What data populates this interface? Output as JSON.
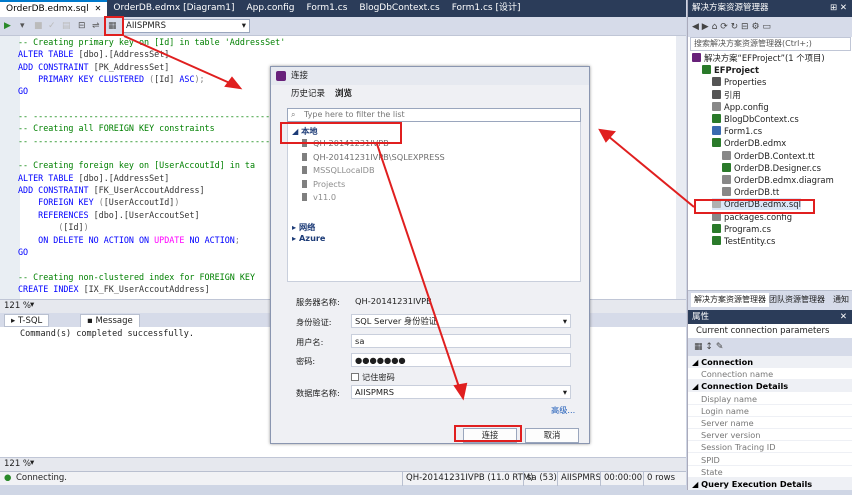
{
  "tabs": [
    {
      "label": "OrderDB.edmx.sql",
      "active": true
    },
    {
      "label": "OrderDB.edmx [Diagram1]"
    },
    {
      "label": "App.config"
    },
    {
      "label": "Form1.cs"
    },
    {
      "label": "BlogDbContext.cs"
    },
    {
      "label": "Form1.cs [设计]"
    }
  ],
  "toolbar": {
    "database_selected": "AIISPMRS"
  },
  "code_lines": [
    [
      {
        "t": "-- Creating primary key on [Id] in table 'AddressSet'",
        "c": "cm"
      }
    ],
    [
      {
        "t": "ALTER TABLE ",
        "c": "kw"
      },
      {
        "t": "[dbo].[AddressSet]",
        "c": "tx"
      }
    ],
    [
      {
        "t": "ADD CONSTRAINT ",
        "c": "kw"
      },
      {
        "t": "[PK_AddressSet]",
        "c": "tx"
      }
    ],
    [
      {
        "t": "    PRIMARY KEY CLUSTERED ",
        "c": "kw"
      },
      {
        "t": "(",
        "c": "gy"
      },
      {
        "t": "[Id] ",
        "c": "tx"
      },
      {
        "t": "ASC",
        "c": "kw"
      },
      {
        "t": ");",
        "c": "gy"
      }
    ],
    [
      {
        "t": "GO",
        "c": "kw"
      }
    ],
    [
      {
        "t": "",
        "c": "tx"
      }
    ],
    [
      {
        "t": "-- ----------------------------------------------------------",
        "c": "cm"
      }
    ],
    [
      {
        "t": "-- Creating all FOREIGN KEY constraints",
        "c": "cm"
      }
    ],
    [
      {
        "t": "-- ----------------------------------------------------------",
        "c": "cm"
      }
    ],
    [
      {
        "t": "",
        "c": "tx"
      }
    ],
    [
      {
        "t": "-- Creating foreign key on [UserAccoutId] in ta",
        "c": "cm"
      }
    ],
    [
      {
        "t": "ALTER TABLE ",
        "c": "kw"
      },
      {
        "t": "[dbo].[AddressSet]",
        "c": "tx"
      }
    ],
    [
      {
        "t": "ADD CONSTRAINT ",
        "c": "kw"
      },
      {
        "t": "[FK_UserAccoutAddress]",
        "c": "tx"
      }
    ],
    [
      {
        "t": "    FOREIGN KEY ",
        "c": "kw"
      },
      {
        "t": "(",
        "c": "gy"
      },
      {
        "t": "[UserAccoutId]",
        "c": "tx"
      },
      {
        "t": ")",
        "c": "gy"
      }
    ],
    [
      {
        "t": "    REFERENCES ",
        "c": "kw"
      },
      {
        "t": "[dbo].[UserAccoutSet]",
        "c": "tx"
      }
    ],
    [
      {
        "t": "        (",
        "c": "gy"
      },
      {
        "t": "[Id]",
        "c": "tx"
      },
      {
        "t": ")",
        "c": "gy"
      }
    ],
    [
      {
        "t": "    ON DELETE NO ACTION ON ",
        "c": "kw"
      },
      {
        "t": "UPDATE",
        "c": "mg"
      },
      {
        "t": " NO ACTION",
        "c": "kw"
      },
      {
        "t": ";",
        "c": "gy"
      }
    ],
    [
      {
        "t": "GO",
        "c": "kw"
      }
    ],
    [
      {
        "t": "",
        "c": "tx"
      }
    ],
    [
      {
        "t": "-- Creating non-clustered index for FOREIGN KEY",
        "c": "cm"
      }
    ],
    [
      {
        "t": "CREATE INDEX ",
        "c": "kw"
      },
      {
        "t": "[IX_FK_UserAccoutAddress]",
        "c": "tx"
      }
    ]
  ],
  "editor_zoom": "121 %",
  "results": {
    "tab1": "T-SQL",
    "tab2": "Message",
    "message": "Command(s) completed successfully."
  },
  "results_zoom": "121 %",
  "status": {
    "left": "Connecting.",
    "server": "QH-20141231IVPB (11.0 RTM)",
    "user": "sa (53)",
    "db": "AIISPMRS",
    "time": "00:00:00",
    "rows": "0 rows"
  },
  "solution_explorer": {
    "title": "解决方案资源管理器",
    "search_placeholder": "搜索解决方案资源管理器(Ctrl+;)",
    "items": [
      {
        "label": "解决方案“EFProject”(1 个项目)",
        "level": 0,
        "color": "#68217a"
      },
      {
        "label": "EFProject",
        "level": 1,
        "bold": true,
        "color": "#2a7a2a"
      },
      {
        "label": "Properties",
        "level": 2,
        "color": "#555"
      },
      {
        "label": "引用",
        "level": 2,
        "color": "#555"
      },
      {
        "label": "App.config",
        "level": 2,
        "color": "#888"
      },
      {
        "label": "BlogDbContext.cs",
        "level": 2,
        "color": "#2a7a2a"
      },
      {
        "label": "Form1.cs",
        "level": 2,
        "color": "#3a6ab0"
      },
      {
        "label": "OrderDB.edmx",
        "level": 2,
        "color": "#2a7a2a"
      },
      {
        "label": "OrderDB.Context.tt",
        "level": 3,
        "color": "#888"
      },
      {
        "label": "OrderDB.Designer.cs",
        "level": 3,
        "color": "#2a7a2a"
      },
      {
        "label": "OrderDB.edmx.diagram",
        "level": 3,
        "color": "#888"
      },
      {
        "label": "OrderDB.tt",
        "level": 3,
        "color": "#888"
      },
      {
        "label": "OrderDB.edmx.sql",
        "level": 2,
        "color": "#b0b0b0",
        "selected": true
      },
      {
        "label": "packages.config",
        "level": 2,
        "color": "#888"
      },
      {
        "label": "Program.cs",
        "level": 2,
        "color": "#2a7a2a"
      },
      {
        "label": "TestEntity.cs",
        "level": 2,
        "color": "#2a7a2a"
      }
    ],
    "bottom_tabs": [
      "解决方案资源管理器",
      "团队资源管理器",
      "通知"
    ]
  },
  "properties": {
    "title": "属性",
    "subtitle": "Current connection parameters",
    "rows": [
      {
        "label": "Connection",
        "cat": true
      },
      {
        "label": "Connection name"
      },
      {
        "label": "Connection Details",
        "cat": true
      },
      {
        "label": "Display name"
      },
      {
        "label": "Login name"
      },
      {
        "label": "Server name"
      },
      {
        "label": "Server version"
      },
      {
        "label": "Session Tracing ID"
      },
      {
        "label": "SPID"
      },
      {
        "label": "State"
      },
      {
        "label": "Query Execution Details",
        "cat": true
      }
    ]
  },
  "dialog": {
    "title": "连接",
    "tab_history": "历史记录",
    "tab_browse": "浏览",
    "filter_placeholder": "Type here to filter the list",
    "local": "本地",
    "servers": [
      "QH-20141231IVPB",
      "QH-20141231IVPB\\SQLEXPRESS",
      "MSSQLLocalDB",
      "Projects",
      "v11.0"
    ],
    "network": "网络",
    "azure": "Azure",
    "server_label": "服务器名称:",
    "server_value": "QH-20141231IVPB",
    "auth_label": "身份验证:",
    "auth_value": "SQL Server 身份验证",
    "user_label": "用户名:",
    "user_value": "sa",
    "pwd_label": "密码:",
    "pwd_value": "●●●●●●●",
    "remember": "记住密码",
    "db_label": "数据库名称:",
    "db_value": "AIISPMRS",
    "advanced": "高级...",
    "connect": "连接",
    "cancel": "取消"
  }
}
